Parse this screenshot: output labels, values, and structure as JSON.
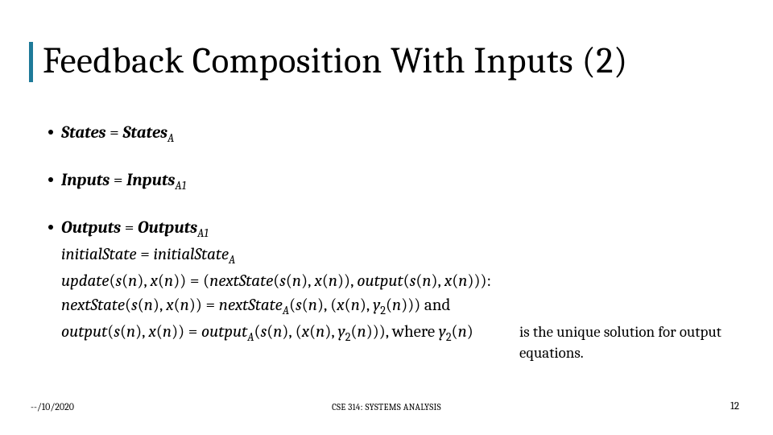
{
  "title": "Feedback Composition With Inputs (2)",
  "unique_note": "is the unique solution for output equations.",
  "footer": {
    "date": "--/10/2020",
    "center": "CSE 314: SYSTEMS ANALYSIS",
    "page": "12"
  },
  "equations": {
    "states_lhs": "States",
    "states_eq": " = ",
    "states_rhs": "States",
    "states_sub": "A",
    "inputs_lhs": "Inputs",
    "inputs_rhs": "Inputs",
    "inputs_sub": "A1",
    "outputs_lhs": "Outputs",
    "outputs_rhs": "Outputs",
    "outputs_sub": "A1",
    "init_lhs": "initialState",
    "init_rhs": "initialState",
    "init_sub": "A",
    "update_a": "update",
    "update_b": "nextState",
    "update_c": "output",
    "sn": "s",
    "xn": "x",
    "n": "n",
    "y2": "y",
    "y2sub": "2",
    "subA": "A",
    "and": " and",
    "where": " where "
  }
}
